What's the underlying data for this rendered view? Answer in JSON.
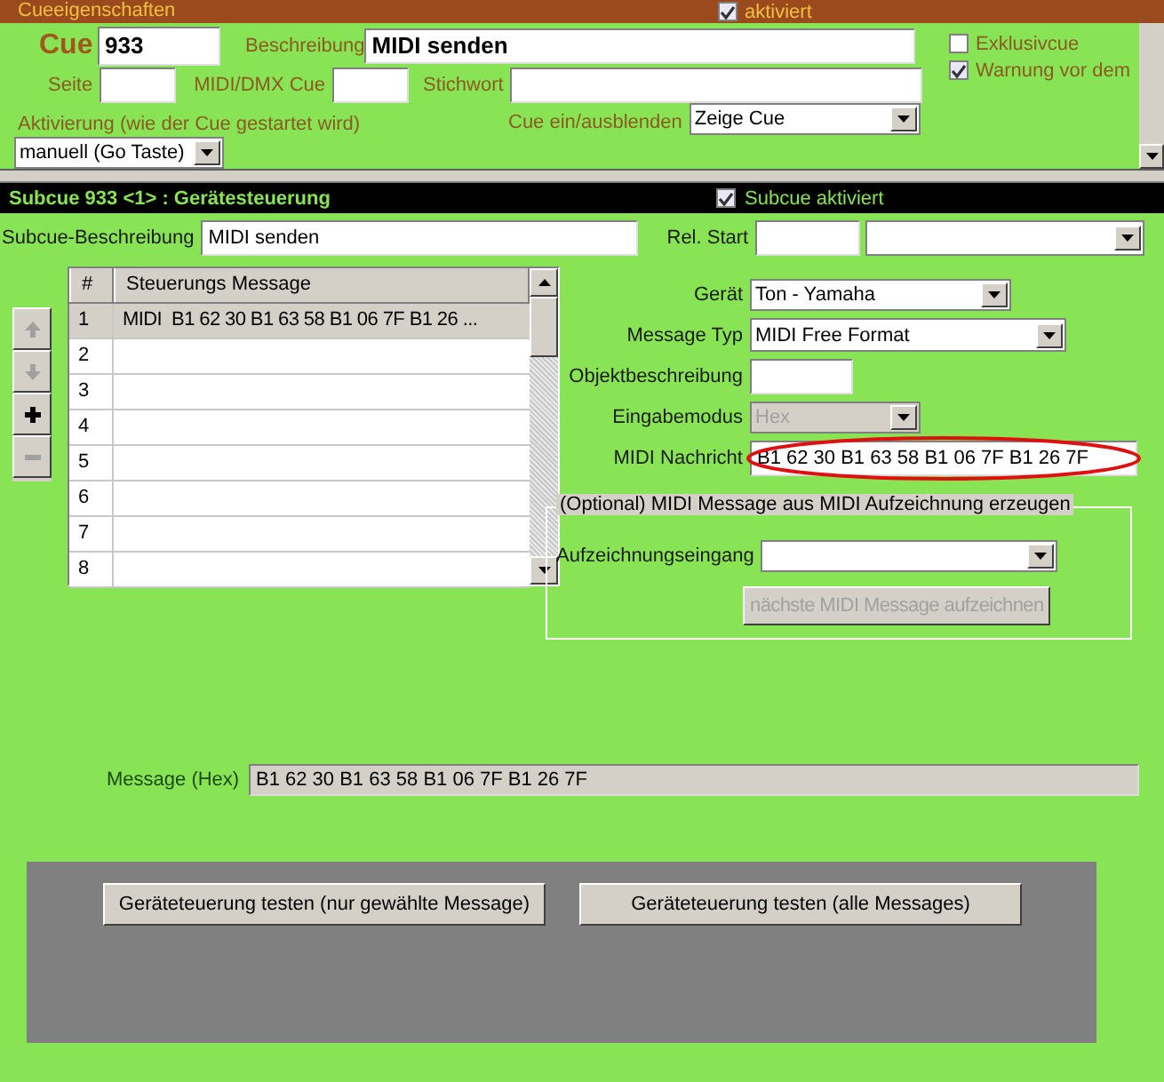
{
  "cue_properties": {
    "title": "Cueeigenschaften",
    "activated": {
      "label": "aktiviert",
      "checked": true
    },
    "cue_label": "Cue",
    "cue_number": "933",
    "description_label": "Beschreibung",
    "description": "MIDI senden",
    "page_label": "Seite",
    "midi_dmx_label": "MIDI/DMX Cue",
    "keyword_label": "Stichwort",
    "options": [
      {
        "label": "Exklusivcue",
        "checked": false
      },
      {
        "label": "Warnung vor dem",
        "checked": true
      }
    ],
    "activation_label": "Aktivierung (wie der Cue gestartet wird)",
    "activation": "manuell (Go Taste)",
    "fade_label": "Cue ein/ausblenden",
    "fade": "Zeige Cue"
  },
  "subcue": {
    "title": "Subcue 933 <1> : Gerätesteuerung",
    "activated": {
      "label": "Subcue aktiviert",
      "checked": true
    },
    "description_label": "Subcue-Beschreibung",
    "description": "MIDI senden",
    "rel_start_label": "Rel. Start",
    "table": {
      "columns": [
        "#",
        "Steuerungs Message"
      ],
      "rows": [
        {
          "cells": [
            "1",
            "MIDI  B1 62 30 B1 63 58 B1 06 7F B1 26 ..."
          ],
          "selected": true
        },
        {
          "cells": [
            "2"
          ],
          "selected": false
        },
        {
          "cells": [
            "3"
          ],
          "selected": false
        },
        {
          "cells": [
            "4"
          ],
          "selected": false
        },
        {
          "cells": [
            "5"
          ],
          "selected": false
        },
        {
          "cells": [
            "6"
          ],
          "selected": false
        },
        {
          "cells": [
            "7"
          ],
          "selected": false
        },
        {
          "cells": [
            "8"
          ],
          "selected": false
        }
      ]
    },
    "row_buttons": [
      {
        "kind": "up",
        "disabled": true
      },
      {
        "kind": "down",
        "disabled": true
      },
      {
        "kind": "add",
        "disabled": false
      },
      {
        "kind": "remove",
        "disabled": true
      }
    ],
    "fields": [
      {
        "label": "Gerät",
        "kind": "select",
        "value": "Ton - Yamaha",
        "disabled": false,
        "highlighted": false
      },
      {
        "label": "Message Typ",
        "kind": "select",
        "value": "MIDI Free Format",
        "disabled": false,
        "highlighted": false
      },
      {
        "label": "Objektbeschreibung",
        "kind": "text",
        "disabled": false,
        "highlighted": false
      },
      {
        "label": "Eingabemodus",
        "kind": "select",
        "value": "Hex",
        "disabled": true,
        "highlighted": false
      },
      {
        "label": "MIDI Nachricht",
        "kind": "text",
        "value": "B1 62 30 B1 63 58 B1 06 7F B1 26 7F",
        "disabled": false,
        "highlighted": true
      }
    ],
    "recording": {
      "legend": "(Optional) MIDI Message aus MIDI Aufzeichnung erzeugen",
      "input_label": "Aufzeichnungseingang",
      "button": {
        "label": "nächste MIDI Message aufzeichnen",
        "disabled": true
      }
    },
    "message_hex_label": "Message (Hex)",
    "message_hex": "B1 62 30 B1 63 58 B1 06 7F B1 26 7F",
    "test_buttons": [
      "Geräteteuerung testen (nur gewählte Message)",
      "Geräteteuerung testen (alle Messages)"
    ]
  }
}
